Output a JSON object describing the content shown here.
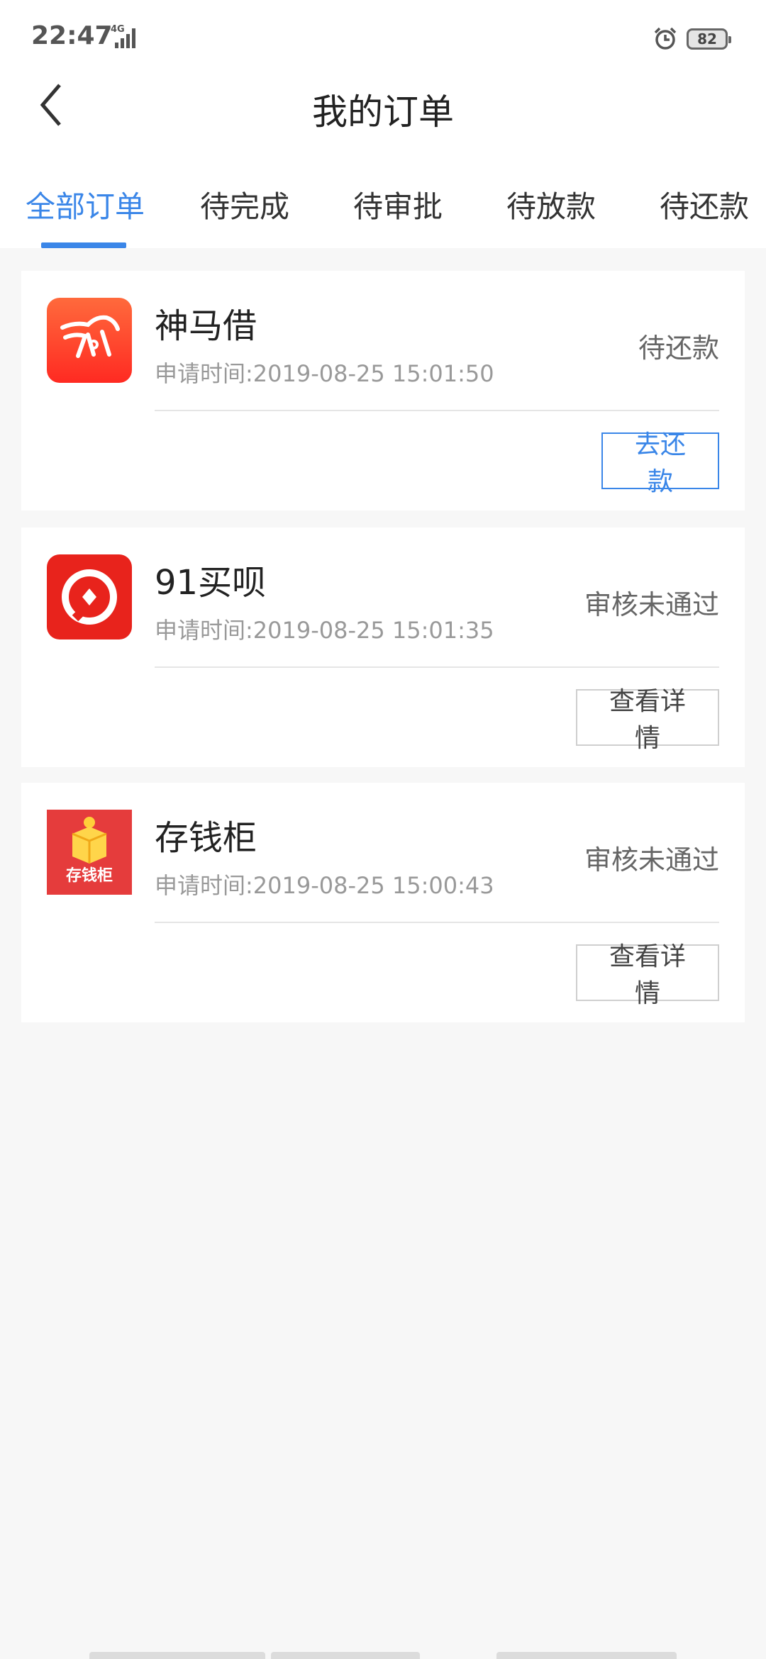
{
  "status_bar": {
    "time": "22:47",
    "network": "4G",
    "battery": "82",
    "alarm_icon": "alarm-icon",
    "signal_icon": "signal-icon"
  },
  "header": {
    "title": "我的订单",
    "back_icon": "back-arrow-icon"
  },
  "tabs": [
    {
      "label": "全部订单",
      "active": true
    },
    {
      "label": "待完成",
      "active": false
    },
    {
      "label": "待审批",
      "active": false
    },
    {
      "label": "待放款",
      "active": false
    },
    {
      "label": "待还款",
      "active": false
    }
  ],
  "orders": [
    {
      "name": "神马借",
      "time": "申请时间:2019-08-25 15:01:50",
      "status": "待还款",
      "button": "去还款",
      "logo_color": "#ff3b2f"
    },
    {
      "name": "91买呗",
      "time": "申请时间:2019-08-25 15:01:35",
      "status": "审核未通过",
      "button": "查看详情",
      "logo_color": "#e8231c"
    },
    {
      "name": "存钱柜",
      "time": "申请时间:2019-08-25 15:00:43",
      "status": "审核未通过",
      "button": "查看详情",
      "logo_color": "#e53c3c",
      "logo_text": "存钱柜"
    }
  ],
  "colors": {
    "accent": "#3a86e8",
    "background": "#f7f7f7"
  }
}
